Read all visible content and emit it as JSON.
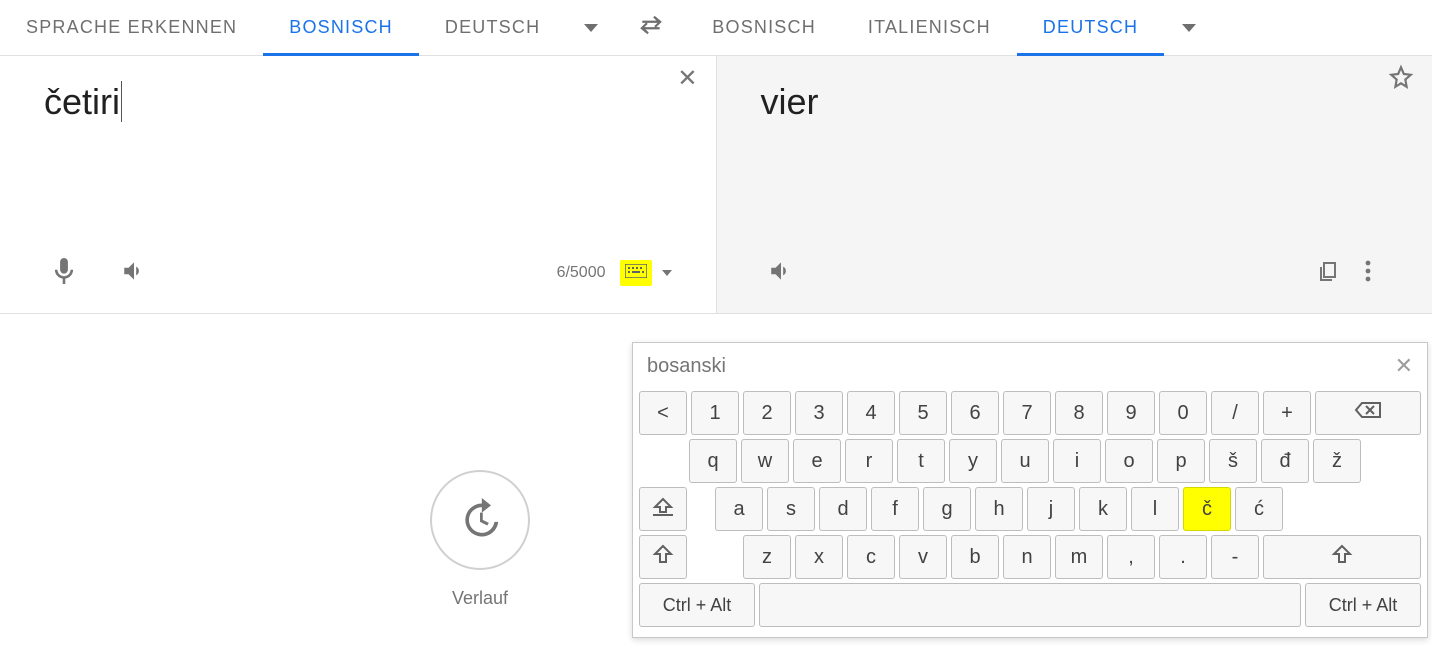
{
  "tabs": {
    "source": {
      "detect": "SPRACHE ERKENNEN",
      "l1": "BOSNISCH",
      "l2": "DEUTSCH"
    },
    "target": {
      "l1": "BOSNISCH",
      "l2": "ITALIENISCH",
      "l3": "DEUTSCH"
    }
  },
  "source": {
    "text": "četiri",
    "char_count": "6/5000"
  },
  "target": {
    "text": "vier"
  },
  "history_label": "Verlauf",
  "vkbd": {
    "title": "bosanski",
    "rows": {
      "r1": [
        "<",
        "1",
        "2",
        "3",
        "4",
        "5",
        "6",
        "7",
        "8",
        "9",
        "0",
        "/",
        "+"
      ],
      "r2": [
        "q",
        "w",
        "e",
        "r",
        "t",
        "y",
        "u",
        "i",
        "o",
        "p",
        "š",
        "đ",
        "ž"
      ],
      "r3": [
        "a",
        "s",
        "d",
        "f",
        "g",
        "h",
        "j",
        "k",
        "l",
        "č",
        "ć"
      ],
      "r4": [
        "z",
        "x",
        "c",
        "v",
        "b",
        "n",
        "m",
        ",",
        ".",
        "-"
      ]
    },
    "ctrl_label": "Ctrl + Alt",
    "highlight_key": "č"
  }
}
